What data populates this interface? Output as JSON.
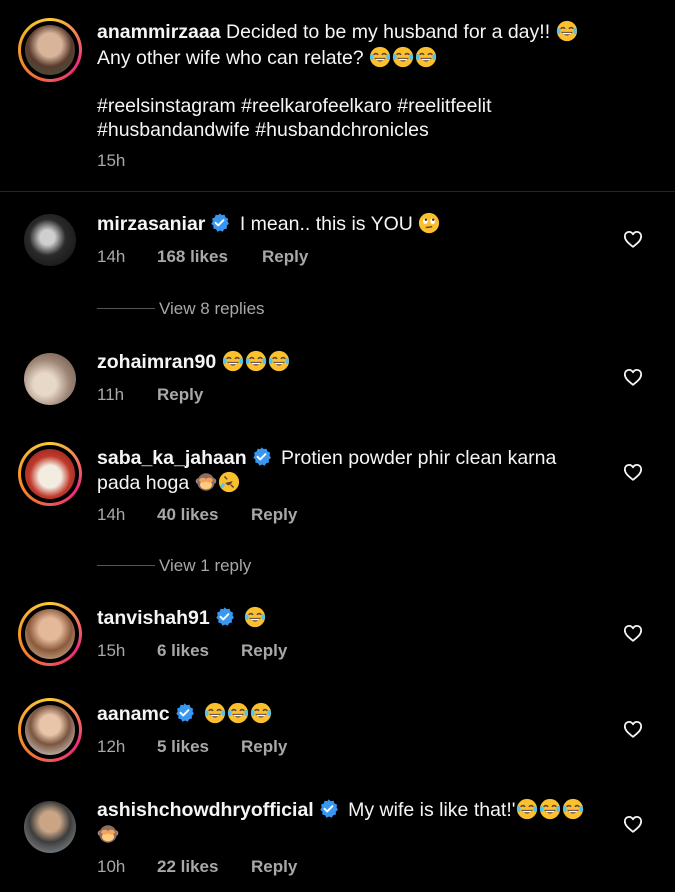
{
  "caption": {
    "username": "anammirzaaa",
    "line1": "Decided to be my husband for a day!!",
    "line2": "Any other wife who can relate?",
    "hashtags_line1": "#reelsinstagram #reelkarofeelkaro #reelitfeelit",
    "hashtags_line2": "#husbandandwife #husbandchronicles",
    "time": "15h"
  },
  "comments": [
    {
      "username": "mirzasaniar",
      "verified": true,
      "text": "I mean.. this is YOU",
      "time": "14h",
      "likes": "168 likes",
      "reply": "Reply",
      "view_replies": "View 8 replies"
    },
    {
      "username": "zohaimran90",
      "verified": false,
      "text": "",
      "time": "11h",
      "likes": "",
      "reply": "Reply"
    },
    {
      "username": "saba_ka_jahaan",
      "verified": true,
      "text": "Protien powder phir clean karna",
      "text2": "pada hoga",
      "time": "14h",
      "likes": "40 likes",
      "reply": "Reply",
      "view_replies": "View 1 reply"
    },
    {
      "username": "tanvishah91",
      "verified": true,
      "text": "",
      "time": "15h",
      "likes": "6 likes",
      "reply": "Reply"
    },
    {
      "username": "aanamc",
      "verified": true,
      "text": "",
      "time": "12h",
      "likes": "5 likes",
      "reply": "Reply"
    },
    {
      "username": "ashishchowdhryofficial",
      "verified": true,
      "text": "My wife is like that!'",
      "time": "10h",
      "likes": "22 likes",
      "reply": "Reply"
    }
  ],
  "colors": {
    "background": "#000000",
    "text": "#f5f5f5",
    "meta": "#a8a8a8",
    "verified": "#3897f0"
  }
}
